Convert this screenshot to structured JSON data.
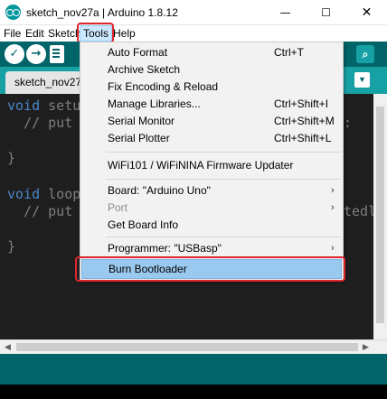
{
  "window": {
    "title": "sketch_nov27a | Arduino 1.8.12",
    "minimize_glyph": "—",
    "maximize_glyph": "☐",
    "close_glyph": "✕"
  },
  "menubar": {
    "items": [
      "File",
      "Edit",
      "Sketch",
      "Tools",
      "Help"
    ]
  },
  "toolbar": {
    "verify_glyph": "✓",
    "upload_glyph": "→",
    "monitor_glyph": "⌕"
  },
  "tabs": {
    "file_tab": "sketch_nov27a",
    "menu_glyph": "▼"
  },
  "editor": {
    "lines": [
      {
        "keyword": "void",
        "rest": " setu"
      },
      {
        "keyword": "",
        "rest": "  // put"
      },
      {
        "keyword": "",
        "rest": "}"
      },
      {
        "keyword": "void",
        "rest": " loop"
      },
      {
        "keyword": "",
        "rest": "  // put"
      },
      {
        "keyword": "",
        "rest": "}"
      }
    ],
    "right_fragments": [
      ":",
      "tedl"
    ]
  },
  "tools_menu": {
    "items": [
      {
        "label": "Auto Format",
        "shortcut": "Ctrl+T"
      },
      {
        "label": "Archive Sketch",
        "shortcut": ""
      },
      {
        "label": "Fix Encoding & Reload",
        "shortcut": ""
      },
      {
        "label": "Manage Libraries...",
        "shortcut": "Ctrl+Shift+I"
      },
      {
        "label": "Serial Monitor",
        "shortcut": "Ctrl+Shift+M"
      },
      {
        "label": "Serial Plotter",
        "shortcut": "Ctrl+Shift+L"
      },
      {
        "label": "WiFi101 / WiFiNINA Firmware Updater",
        "shortcut": ""
      },
      {
        "label": "Board: \"Arduino Uno\"",
        "shortcut": ""
      },
      {
        "label": "Port",
        "shortcut": ""
      },
      {
        "label": "Get Board Info",
        "shortcut": ""
      },
      {
        "label": "Programmer: \"USBasp\"",
        "shortcut": ""
      },
      {
        "label": "Burn Bootloader",
        "shortcut": ""
      }
    ],
    "submenu_arrow": "›"
  },
  "colors": {
    "toolbar": "#006468",
    "tabstrip": "#17a1a5",
    "editor_bg": "#1e1e1e",
    "keyword": "#4a86c9",
    "selection": "#99c9ef",
    "highlight_outline": "#e0262d"
  }
}
